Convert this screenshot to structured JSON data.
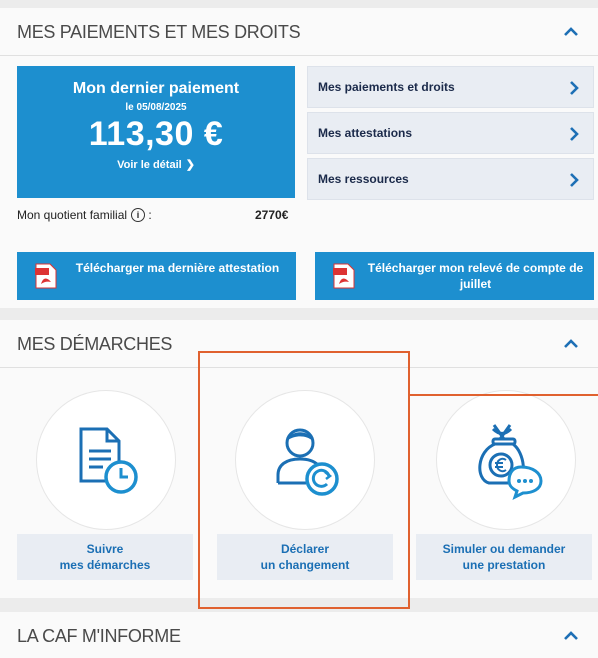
{
  "payments": {
    "title": "MES PAIEMENTS ET MES DROITS",
    "last_payment": {
      "title": "Mon dernier paiement",
      "date": "le 05/08/2025",
      "amount": "113,30 €",
      "detail_link": "Voir le détail"
    },
    "links": [
      {
        "label": "Mes paiements et droits"
      },
      {
        "label": "Mes attestations"
      },
      {
        "label": "Mes ressources"
      }
    ],
    "quotient": {
      "label": "Mon quotient familial",
      "value": "2770€"
    },
    "downloads": [
      {
        "label": "Télécharger ma dernière attestation"
      },
      {
        "label": "Télécharger mon relevé de compte de juillet"
      }
    ]
  },
  "demarches": {
    "title": "MES DÉMARCHES",
    "actions": [
      {
        "label_line1": "Suivre",
        "label_line2": "mes démarches",
        "icon": "document-clock-icon"
      },
      {
        "label_line1": "Déclarer",
        "label_line2": "un changement",
        "icon": "user-refresh-icon"
      },
      {
        "label_line1": "Simuler ou demander",
        "label_line2": "une prestation",
        "icon": "money-bag-chat-icon"
      }
    ]
  },
  "info": {
    "title": "LA CAF M'INFORME"
  },
  "colors": {
    "primary_blue": "#1d8fcf",
    "icon_blue": "#1b6fb4",
    "highlight": "#e0612f"
  }
}
